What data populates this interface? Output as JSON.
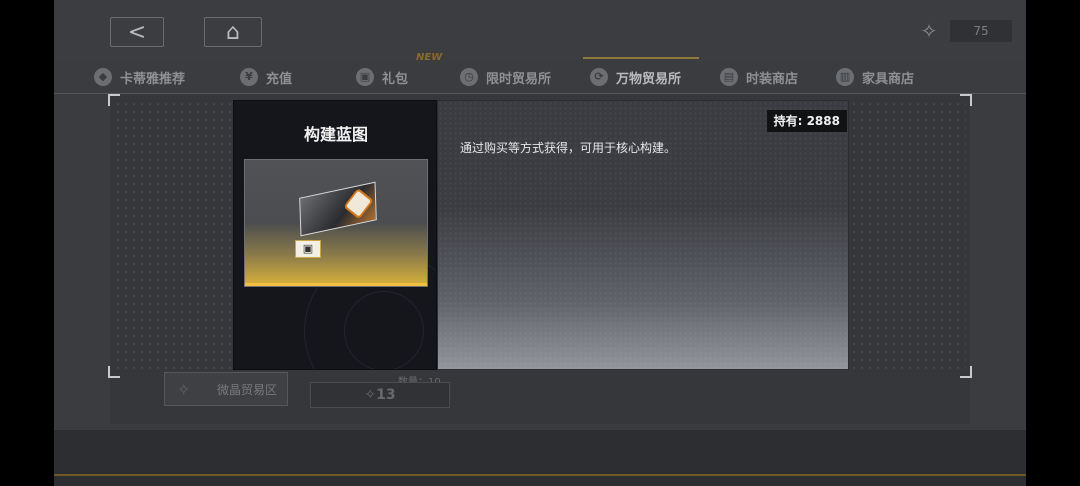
{
  "topbar": {
    "back_icon": "back-arrow-icon",
    "home_icon": "home-icon",
    "currency": {
      "icon": "crystal-icon",
      "value": "75"
    }
  },
  "tabs": [
    {
      "label": "卡蒂雅推荐",
      "icon": "recommend-icon"
    },
    {
      "label": "充值",
      "icon": "yen-icon"
    },
    {
      "label": "礼包",
      "icon": "gift-icon",
      "badge": "NEW"
    },
    {
      "label": "限时贸易所",
      "icon": "clock-icon"
    },
    {
      "label": "万物贸易所",
      "icon": "exchange-icon",
      "active": true
    },
    {
      "label": "时装商店",
      "icon": "wardrobe-icon"
    },
    {
      "label": "家具商店",
      "icon": "furniture-icon"
    }
  ],
  "background": {
    "item_label": "微晶贸易区",
    "price": "13",
    "count_label": "数量：10"
  },
  "modal": {
    "title": "构建蓝图",
    "owned": "持有: 2888",
    "description": "通过购买等方式获得，可用于核心构建。",
    "item_icon": "blueprint-card-icon"
  }
}
